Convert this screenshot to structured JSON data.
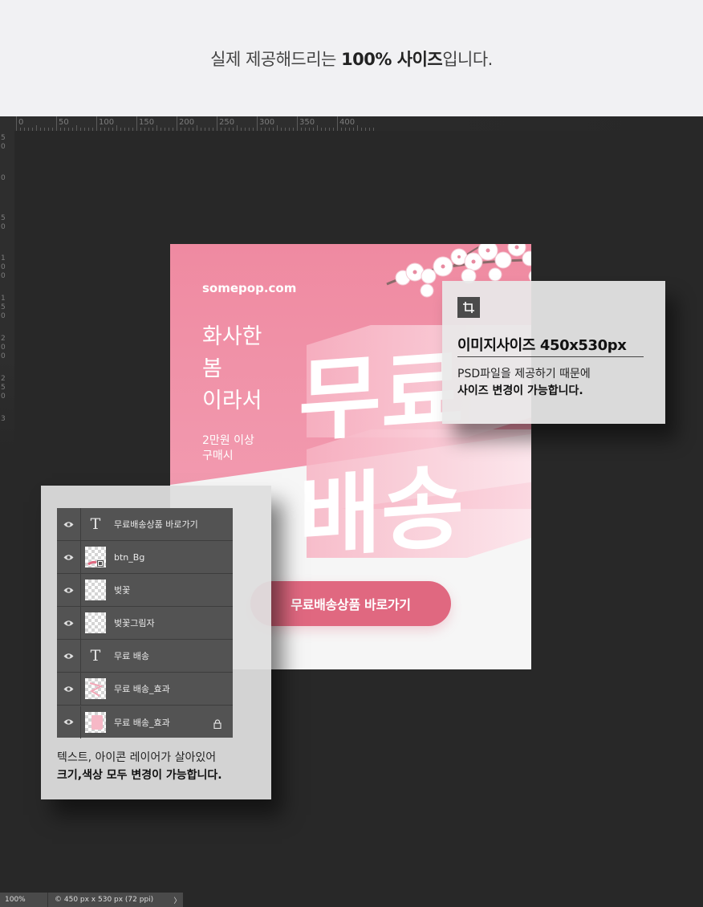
{
  "banner": {
    "text_pre": "실제 제공해드리는 ",
    "text_bold": "100% 사이즈",
    "text_post": "입니다."
  },
  "ruler": {
    "horizontal_labels": [
      "0",
      "50",
      "100",
      "150",
      "200",
      "250",
      "300",
      "350",
      "400"
    ],
    "vertical_labels": [
      "50",
      "0",
      "50",
      "100",
      "150",
      "200",
      "250",
      "3"
    ]
  },
  "poster": {
    "site": "somepop.com",
    "tagline": [
      "화사한",
      "봄",
      "이라서"
    ],
    "condition": [
      "2만원 이상",
      "구매시"
    ],
    "headline": [
      "무료",
      "배송"
    ],
    "cta_label": "무료배송상품 바로가기"
  },
  "info_card": {
    "icon": "crop-icon",
    "title": "이미지사이즈 450x530px",
    "desc_line1": "PSD파일을 제공하기 때문에",
    "desc_line2": "사이즈 변경이 가능합니다."
  },
  "layers": [
    {
      "type": "text",
      "name": "무료배송상품 바로가기"
    },
    {
      "type": "image",
      "name": "btn_Bg"
    },
    {
      "type": "image",
      "name": "벚꽃"
    },
    {
      "type": "image",
      "name": "벚꽃그림자"
    },
    {
      "type": "text",
      "name": "무료 배송"
    },
    {
      "type": "image",
      "name": "무료 배송_효과"
    },
    {
      "type": "image",
      "name": "무료 배송_효과",
      "locked": true
    }
  ],
  "layers_note": {
    "line1": "텍스트, 아이콘 레이어가 살아있어",
    "line2": "크기,색상 모두 변경이 가능합니다."
  },
  "status_bar": {
    "zoom": "100%",
    "doc_info": "© 450 px x 530 px (72 ppi)",
    "arrow": "〉"
  },
  "colors": {
    "pink": "#ef8aa1",
    "cta": "#e06880",
    "workspace": "#282828"
  }
}
